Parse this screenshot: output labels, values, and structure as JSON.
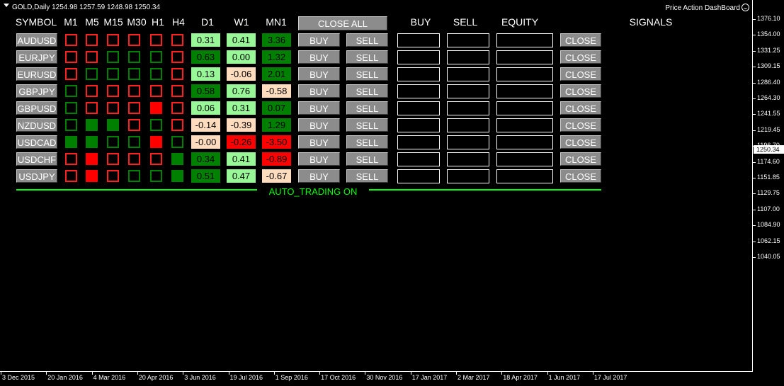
{
  "window": {
    "symbol_info": "GOLD,Daily   1254.98 1257.59 1248.98 1250.34",
    "dashboard_title": "Price Action DashBoard"
  },
  "headers": {
    "symbol": "SYMBOL",
    "timeframes": [
      "M1",
      "M5",
      "M15",
      "M30",
      "H1",
      "H4"
    ],
    "periods": [
      "D1",
      "W1",
      "MN1"
    ],
    "close_all": "CLOSE ALL",
    "buy": "BUY",
    "sell": "SELL",
    "equity": "EQUITY",
    "signals": "SIGNALS"
  },
  "row_buttons": {
    "buy": "BUY",
    "sell": "SELL",
    "close": "CLOSE"
  },
  "rows": [
    {
      "symbol": "AUDUSD",
      "signals": [
        "ro",
        "ro",
        "ro",
        "ro",
        "ro",
        "ro"
      ],
      "values": [
        [
          "0.31",
          "lg"
        ],
        [
          "0.41",
          "lg"
        ],
        [
          "3.36",
          "dg"
        ]
      ]
    },
    {
      "symbol": "EURJPY",
      "signals": [
        "ro",
        "ro",
        "go",
        "go",
        "go",
        "ro"
      ],
      "values": [
        [
          "0.63",
          "dg"
        ],
        [
          "0.00",
          "lg"
        ],
        [
          "1.32",
          "dg"
        ]
      ]
    },
    {
      "symbol": "EURUSD",
      "signals": [
        "ro",
        "go",
        "go",
        "go",
        "go",
        "ro"
      ],
      "values": [
        [
          "0.13",
          "lg"
        ],
        [
          "-0.06",
          "pk"
        ],
        [
          "2.01",
          "dg"
        ]
      ]
    },
    {
      "symbol": "GBPJPY",
      "signals": [
        "go",
        "ro",
        "ro",
        "ro",
        "ro",
        "ro"
      ],
      "values": [
        [
          "0.58",
          "dg"
        ],
        [
          "0.76",
          "lg"
        ],
        [
          "-0.58",
          "pk"
        ]
      ]
    },
    {
      "symbol": "GBPUSD",
      "signals": [
        "go",
        "ro",
        "ro",
        "ro",
        "rf",
        "ro"
      ],
      "values": [
        [
          "0.06",
          "lg"
        ],
        [
          "0.31",
          "lg"
        ],
        [
          "0.07",
          "dg"
        ]
      ]
    },
    {
      "symbol": "NZDUSD",
      "signals": [
        "go",
        "gf",
        "gf",
        "ro",
        "go",
        "ro"
      ],
      "values": [
        [
          "-0.14",
          "pk"
        ],
        [
          "-0.39",
          "pk"
        ],
        [
          "1.29",
          "dg"
        ]
      ]
    },
    {
      "symbol": "USDCAD",
      "signals": [
        "gf",
        "gf",
        "go",
        "go",
        "rf",
        "go"
      ],
      "values": [
        [
          "-0.00",
          "pk"
        ],
        [
          "-0.26",
          "rd"
        ],
        [
          "-3.50",
          "rd"
        ]
      ]
    },
    {
      "symbol": "USDCHF",
      "signals": [
        "ro",
        "rf",
        "ro",
        "ro",
        "ro",
        "gf"
      ],
      "values": [
        [
          "0.34",
          "dg"
        ],
        [
          "0.41",
          "lg"
        ],
        [
          "-0.89",
          "rd"
        ]
      ]
    },
    {
      "symbol": "USDJPY",
      "signals": [
        "ro",
        "rf",
        "ro",
        "go",
        "go",
        "gf"
      ],
      "values": [
        [
          "0.51",
          "dg"
        ],
        [
          "0.47",
          "lg"
        ],
        [
          "-0.67",
          "pk"
        ]
      ]
    }
  ],
  "status": "AUTO_TRADING ON",
  "colors": {
    "dark_green": "#008000",
    "light_green": "#98f898",
    "peach": "#ffdcbe",
    "red": "#ff0000",
    "status_green": "#00ff00"
  },
  "y_axis": {
    "ticks": [
      "1376.10",
      "1354.00",
      "1331.25",
      "1309.15",
      "1286.40",
      "1264.30",
      "1241.55",
      "1219.45",
      "1196.70",
      "1174.60",
      "1151.85",
      "1129.75",
      "1107.00",
      "1084.90",
      "1062.15",
      "1040.05"
    ],
    "current_price": "1250.34"
  },
  "x_axis": {
    "ticks": [
      "3 Dec 2015",
      "20 Jan 2016",
      "4 Mar 2016",
      "20 Apr 2016",
      "3 Jun 2016",
      "19 Jul 2016",
      "1 Sep 2016",
      "17 Oct 2016",
      "30 Nov 2016",
      "17 Jan 2017",
      "2 Mar 2017",
      "18 Apr 2017",
      "1 Jun 2017",
      "17 Jul 2017"
    ]
  }
}
